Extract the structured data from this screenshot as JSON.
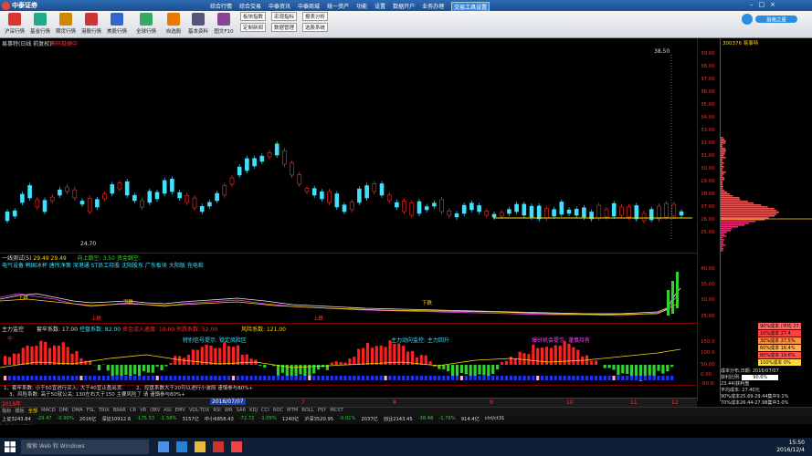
{
  "app": {
    "name": "中泰证券"
  },
  "menu": {
    "items": [
      "综合行情",
      "综合交易",
      "中泰资讯",
      "中泰商城",
      "统一资产",
      "功能",
      "设置",
      "数据开户",
      "业务办理"
    ],
    "highlight": "交易工具设置"
  },
  "toolbar": {
    "items": [
      "沪深行情",
      "基金行情",
      "期货行情",
      "港股行情",
      "美股行情",
      "全球行情",
      "自选股",
      "基本资料",
      "图文F10"
    ],
    "buttons": [
      "板块指数",
      "宏观指标",
      "报表分析",
      "定制新闻",
      "数据管理",
      "选股系统"
    ]
  },
  "brand": {
    "logo_text": "指南之星"
  },
  "main": {
    "stock_label": "易事特(日线 前复权)",
    "secondary": "筹码稳健中",
    "price_tag": "38.50",
    "low_tag": "24.70",
    "right_code": "300376 易事特",
    "price_ticks": [
      "39.00",
      "38.00",
      "37.00",
      "36.00",
      "35.00",
      "34.00",
      "33.00",
      "32.00",
      "31.00",
      "30.00",
      "29.00",
      "28.00",
      "27.00",
      "26.00",
      "25.00"
    ]
  },
  "pane2": {
    "title": "一线测试(5)",
    "val1": "29.49",
    "val2": "29.49",
    "ind1": "向上跳空: 3.50",
    "ind2": "资金跳空:",
    "sectors": "电气设备 韩国冰杯 唐所净策 深港通 ST员工持股 沈阳股东 广东板块 大阳版 充电桩",
    "ticks": [
      "40.00",
      "35.00",
      "30.00",
      "25.00"
    ],
    "marks": [
      "下跌",
      "下跌",
      "下跌",
      "上跌",
      "上跌"
    ]
  },
  "pane3": {
    "title": "主力监控",
    "label1": "套牢系数: 17.00",
    "label2": "控盘系数: 82.00",
    "label3": "资金流入速度: 10.00",
    "label4": "杀跌系数: 52.00",
    "label5": "风险系数: 121.00",
    "bull": "牛",
    "legend1": "特别信号提示: 锁定风险区",
    "legend2": "主力动向监控: 主力回升",
    "legend3": "爆好机会提示: 谨慎持有",
    "ticks": [
      "150.0",
      "100.0",
      "50.00",
      "0.00",
      "-50.0"
    ]
  },
  "notes": [
    "1、套牢系数: 小于50宜进行买入; 大于40宜止盈出货.",
    "2、控盘系数大于20可以进行小波段 谨慎参与80%+",
    "3、风险系数: 高于50就公关; 130左右大于150 主要风险了 请 谨慎参与80%+"
  ],
  "xaxis": {
    "labels": [
      "2016年",
      "2016/07/07",
      "7",
      "8",
      "9",
      "10",
      "11",
      "12"
    ]
  },
  "bottomtabs": [
    "指标",
    "模板",
    "全部",
    "MACD",
    "DMI",
    "DMA",
    "FSL",
    "TRIX",
    "BRAR",
    "CR",
    "VR",
    "OBV",
    "ASI",
    "EMV",
    "VOL-TDX",
    "RSI",
    "WR",
    "SAR",
    "KDJ",
    "CCI",
    "ROC",
    "MTM",
    "BOLL",
    "PSY",
    "MCST"
  ],
  "side_tabs": [
    "扩展行",
    "关联报价"
  ],
  "profile": {
    "cost_rows": [
      "90%成本 (平均 27.9",
      "10%成本 27.4",
      "30%成本 27.5%",
      "60%成本 16.4%",
      "80%成本 19.6%",
      "100%成本 0%"
    ],
    "date_label": "成本分布,日期: 2016/07/07",
    "profit_label": "获利比例:",
    "profit_val": "90.6%",
    "avg_label": "23.44(获利盘",
    "avg_cost": "平均成本: 27.40元",
    "c90": "90%成本25.69-29.44集中9.1%",
    "c70": "70%成本26.44-27.98集中3.0%",
    "colors": {
      "a": "#ff6a6a",
      "b": "#ff4040",
      "c": "#ff8c40",
      "d": "#ffb050",
      "e": "#ff5050",
      "f": "#ffe040"
    }
  },
  "statusbar": [
    "上证3243.84",
    "-29.47",
    "-0.90%",
    "2016亿",
    "深证10912.6",
    "-175.53",
    "-1.58%",
    "3157亿",
    "中小6858.43",
    "-72.72",
    "-1.05%",
    "1240亿",
    "沪深3520.95",
    "-0.01%",
    "2037亿",
    "创业2143.45",
    "-38.48",
    "-1.76%",
    "914.4亿",
    "ctrl/ct31"
  ],
  "taskbar": {
    "search": "搜索 Web 和 Windows",
    "time": "15:50",
    "date": "2016/12/4"
  }
}
